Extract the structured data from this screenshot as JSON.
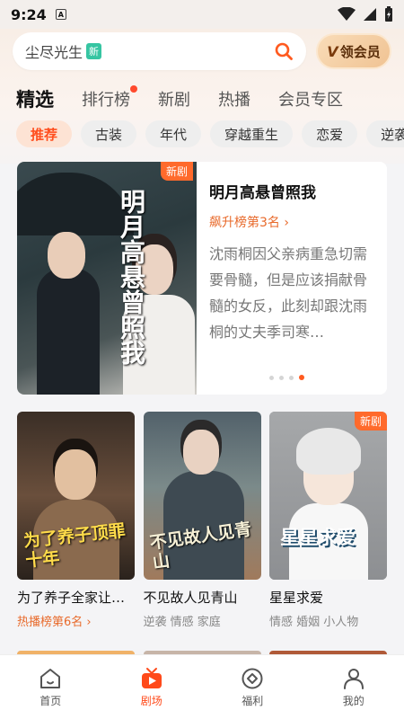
{
  "status_bar": {
    "time": "9:24",
    "notification_icon": "A"
  },
  "search": {
    "text": "尘尽光生",
    "badge": "新"
  },
  "vip": {
    "mark": "V",
    "label": "领会员"
  },
  "main_tabs": [
    {
      "label": "精选",
      "active": true
    },
    {
      "label": "排行榜",
      "has_dot": true
    },
    {
      "label": "新剧"
    },
    {
      "label": "热播"
    },
    {
      "label": "会员专区"
    }
  ],
  "chips": [
    {
      "label": "推荐",
      "active": true
    },
    {
      "label": "古装"
    },
    {
      "label": "年代"
    },
    {
      "label": "穿越重生"
    },
    {
      "label": "恋爱"
    },
    {
      "label": "逆袭"
    }
  ],
  "featured": {
    "tag": "新剧",
    "poster_text": "明月高悬曾照我",
    "title": "明月高悬曾照我",
    "rank": "飙升榜第3名",
    "description": "沈雨桐因父亲病重急切需要骨髓，但是应该捐献骨髓的女反，此刻却跟沈雨桐的丈夫季司寒…",
    "slide_count": 4,
    "active_slide": 4
  },
  "cards": [
    {
      "title": "为了养子全家让…",
      "subtitle": "热播榜第6名",
      "subtitle_is_rank": true,
      "poster_text": "为了养子顶罪十年"
    },
    {
      "title": "不见故人见青山",
      "subtitle": "逆袭 情感 家庭",
      "poster_text": "不见故人见青山"
    },
    {
      "title": "星星求爱",
      "subtitle": "情感 婚姻 小人物",
      "poster_text": "星星求爱",
      "tag": "新剧"
    }
  ],
  "bottom_nav": [
    {
      "label": "首页",
      "icon": "home-icon"
    },
    {
      "label": "剧场",
      "icon": "theater-icon",
      "active": true
    },
    {
      "label": "福利",
      "icon": "welfare-icon"
    },
    {
      "label": "我的",
      "icon": "profile-icon"
    }
  ],
  "colors": {
    "accent": "#ff5a1f",
    "rank": "#e86a2b",
    "new_badge": "#36c5a2"
  }
}
